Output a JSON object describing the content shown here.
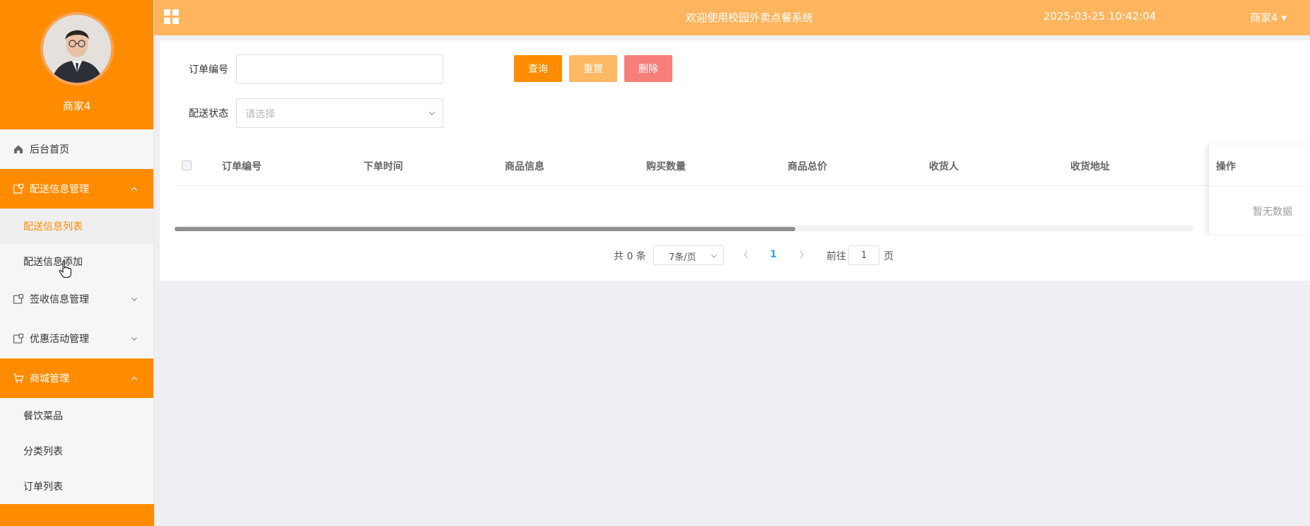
{
  "sidebar": {
    "profile": {
      "name": "商家4"
    },
    "items": [
      {
        "label": "后台首页",
        "icon": "home-icon"
      },
      {
        "label": "配送信息管理",
        "icon": "folder-icon",
        "expanded": true,
        "children": [
          {
            "label": "配送信息列表",
            "current": true
          },
          {
            "label": "配送信息添加"
          }
        ]
      },
      {
        "label": "签收信息管理",
        "icon": "folder-icon",
        "expanded": false
      },
      {
        "label": "优惠活动管理",
        "icon": "folder-icon",
        "expanded": false
      },
      {
        "label": "商城管理",
        "icon": "cart-icon",
        "expanded": true,
        "children": [
          {
            "label": "餐饮菜品"
          },
          {
            "label": "分类列表"
          },
          {
            "label": "订单列表"
          }
        ]
      }
    ]
  },
  "header": {
    "title": "欢迎使用校园外卖点餐系统",
    "datetime": "2025-03-25 10:42:04",
    "user": "商家4"
  },
  "search": {
    "order_no_label": "订单编号",
    "order_no_value": "",
    "status_label": "配送状态",
    "status_placeholder": "请选择",
    "buttons": {
      "query": "查询",
      "reset": "重置",
      "delete": "删除"
    }
  },
  "table": {
    "columns": [
      "订单编号",
      "下单时间",
      "商品信息",
      "购买数量",
      "商品总价",
      "收货人",
      "收货地址"
    ],
    "action_column": "操作",
    "empty_text": "暂无数据",
    "scroll_position": 0.61
  },
  "pagination": {
    "total_prefix": "共 0 条",
    "page_size": "7条/页",
    "current_page": "1",
    "goto_label": "前往",
    "goto_value": "1",
    "page_suffix": "页"
  },
  "colors": {
    "accent": "#ff8c00",
    "header": "#ffb55e",
    "reset": "#ffb863",
    "delete": "#f77f7a",
    "link": "#409eff"
  }
}
